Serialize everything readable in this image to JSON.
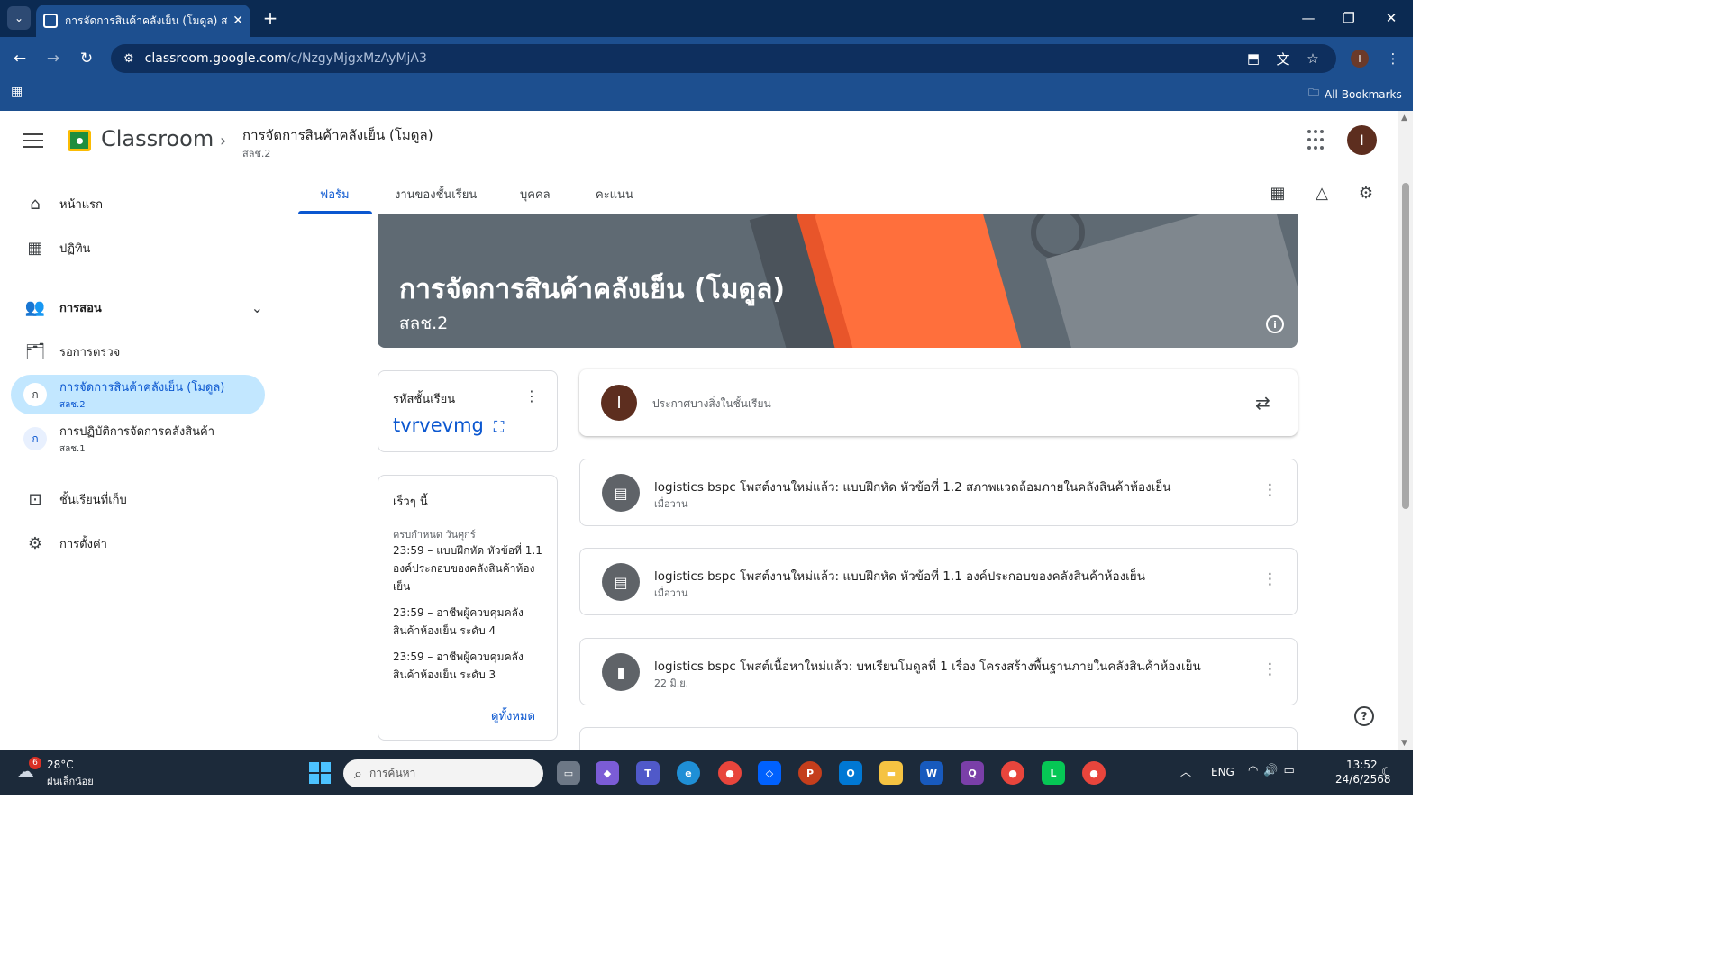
{
  "browser": {
    "tab_title": "การจัดการสินค้าคลังเย็น (โมดูล) สลช.",
    "url_host": "classroom.google.com",
    "url_path": "/c/NzgyMjgxMzAyMjA3",
    "profile_initial": "I",
    "bookmarks_label": "All Bookmarks"
  },
  "header": {
    "app_name": "Classroom",
    "course_title": "การจัดการสินค้าคลังเย็น (โมดูล)",
    "course_section": "สลช.2",
    "avatar_initial": "I"
  },
  "sidebar": {
    "home": "หน้าแรก",
    "calendar": "ปฏิทิน",
    "teaching": "การสอน",
    "to_review": "รอการตรวจ",
    "classes": [
      {
        "initial": "ก",
        "name": "การจัดการสินค้าคลังเย็น (โมดูล)",
        "section": "สลช.2"
      },
      {
        "initial": "ก",
        "name": "การปฏิบัติการจัดการคลังสินค้า",
        "section": "สลช.1"
      }
    ],
    "archived": "ชั้นเรียนที่เก็บ",
    "settings": "การตั้งค่า"
  },
  "tabs": [
    "ฟอรัม",
    "งานของชั้นเรียน",
    "บุคคล",
    "คะแนน"
  ],
  "banner": {
    "title": "การจัดการสินค้าคลังเย็น (โมดูล)",
    "subtitle": "สลช.2"
  },
  "class_code": {
    "label": "รหัสชั้นเรียน",
    "value": "tvrvevmg"
  },
  "upcoming": {
    "title": "เร็วๆ นี้",
    "due": "ครบกำหนด วันศุกร์",
    "items": [
      "23:59 – แบบฝึกหัด หัวข้อที่ 1.1 องค์ประกอบของคลังสินค้าห้องเย็น",
      "23:59 – อาชีพผู้ควบคุมคลังสินค้าห้องเย็น ระดับ 4",
      "23:59 – อาชีพผู้ควบคุมคลังสินค้าห้องเย็น ระดับ 3"
    ],
    "view_all": "ดูทั้งหมด"
  },
  "announce": {
    "avatar_initial": "I",
    "placeholder": "ประกาศบางสิ่งในชั้นเรียน"
  },
  "posts": [
    {
      "icon": "assignment-icon",
      "title": "logistics bspc โพสต์งานใหม่แล้ว: แบบฝึกหัด หัวข้อที่ 1.2 สภาพแวดล้อมภายในคลังสินค้าห้องเย็น",
      "date": "เมื่อวาน"
    },
    {
      "icon": "assignment-icon",
      "title": "logistics bspc โพสต์งานใหม่แล้ว: แบบฝึกหัด หัวข้อที่ 1.1 องค์ประกอบของคลังสินค้าห้องเย็น",
      "date": "เมื่อวาน"
    },
    {
      "icon": "material-icon",
      "title": "logistics bspc โพสต์เนื้อหาใหม่แล้ว: บทเรียนโมดูลที่ 1 เรื่อง โครงสร้างพื้นฐานภายในคลังสินค้าห้องเย็น",
      "date": "22 มิ.ย."
    }
  ],
  "taskbar": {
    "weather_badge": "6",
    "temp": "28°C",
    "weather": "ฝนเล็กน้อย",
    "search_placeholder": "การค้นหา",
    "lang": "ENG",
    "time": "13:52",
    "date": "24/6/2568"
  },
  "colors": {
    "accent": "#0b57d0",
    "selected_class_bg": "#c2e7ff",
    "banner_bg": "#5f6a73",
    "browser_toolbar": "#1d4f8f"
  }
}
